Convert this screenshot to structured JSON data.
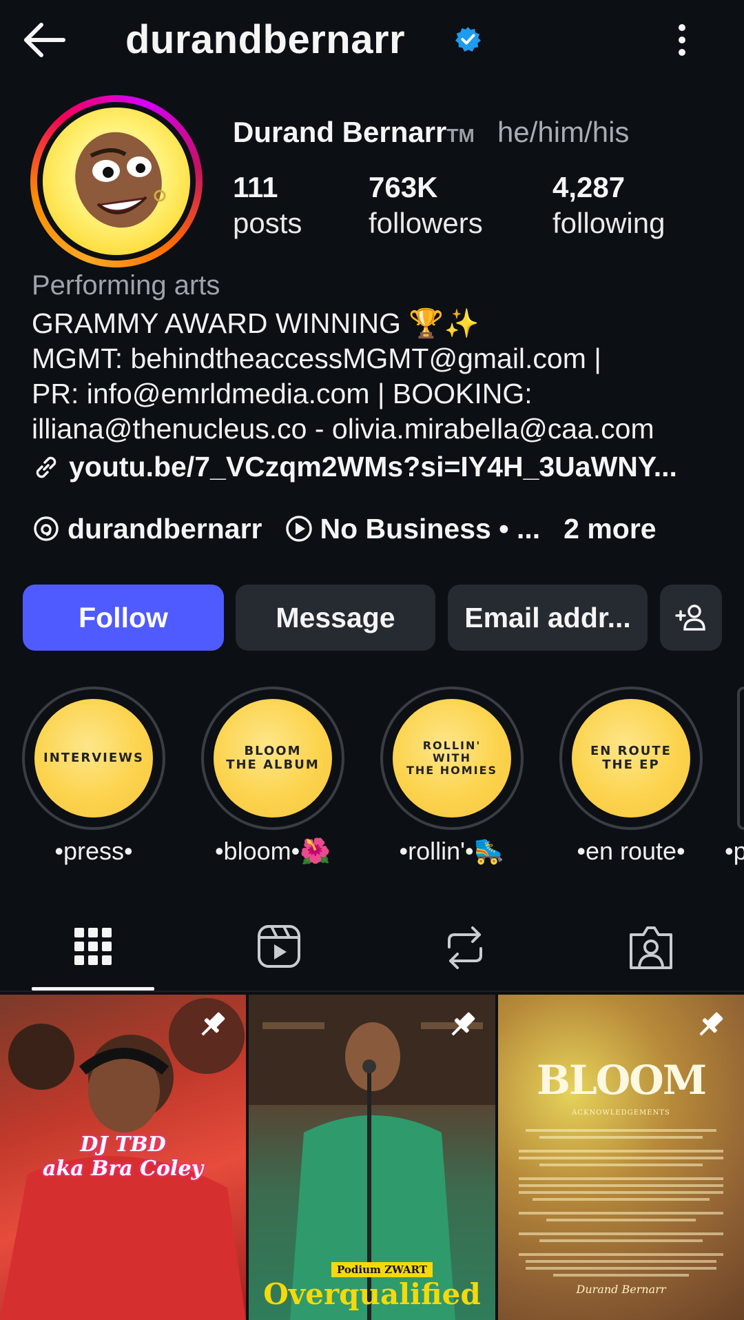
{
  "header": {
    "username": "durandbernarr",
    "back_icon": "arrow-left-icon",
    "verified_icon": "verified-badge-icon",
    "more_icon": "more-vertical-icon"
  },
  "profile": {
    "display_name": "Durand Bernarr",
    "tm": "TM",
    "pronouns": "he/him/his",
    "stats": [
      {
        "value": "111",
        "label": "posts"
      },
      {
        "value": "763K",
        "label": "followers"
      },
      {
        "value": "4,287",
        "label": "following"
      }
    ],
    "category": "Performing arts",
    "bio_lines": [
      "GRAMMY AWARD WINNING 🏆✨",
      "MGMT: behindtheaccessMGMT@gmail.com |",
      "PR: info@emrldmedia.com | BOOKING:",
      "illiana@thenucleus.co - olivia.mirabella@caa.com"
    ],
    "link": "youtu.be/7_VCzqm2WMs?si=IY4H_3UaWNY...",
    "threads_handle": "durandbernarr",
    "media_label": "No Business • ...",
    "more_label": "2 more"
  },
  "actions": {
    "follow": "Follow",
    "message": "Message",
    "email": "Email addr...",
    "add_user_icon": "add-user-icon"
  },
  "highlights": [
    {
      "cover": "INTERVIEWS",
      "label": "•press•"
    },
    {
      "cover": "BLOOM\nTHE ALBUM",
      "label": "•bloom•🌺"
    },
    {
      "cover": "ROLLIN'\nWITH\nTHE HOMIES",
      "label": "•rollin'•🛼"
    },
    {
      "cover": "EN ROUTE\nTHE EP",
      "label": "•en route•"
    },
    {
      "cover": "",
      "label": "•p"
    }
  ],
  "tabs": [
    "grid-icon",
    "reels-icon",
    "reposts-icon",
    "tagged-icon"
  ],
  "posts": [
    {
      "title_line1": "DJ TBD",
      "title_line2": "aka Bra Coley",
      "pinned": true
    },
    {
      "badge": "Podium ZWART",
      "title": "Overqualified",
      "pinned": true
    },
    {
      "title": "BLOOM",
      "subtitle": "ACKNOWLEDGEMENTS",
      "signature": "Durand Bernarr",
      "pinned": true
    }
  ],
  "colors": {
    "background": "#0c0f14",
    "follow_button": "#4f5bff",
    "secondary_button": "#262a31",
    "verified": "#1d9bf0",
    "highlight_yellow": "#fcd34d"
  }
}
